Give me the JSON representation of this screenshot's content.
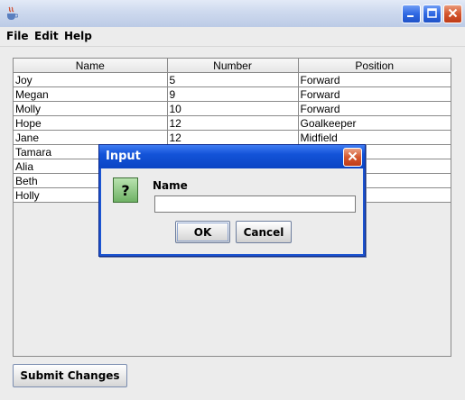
{
  "window": {
    "icons": [
      "java-cup-icon",
      "minimize-icon",
      "maximize-icon",
      "close-icon"
    ]
  },
  "menu": [
    "File",
    "Edit",
    "Help"
  ],
  "table": {
    "columns": [
      "Name",
      "Number",
      "Position"
    ],
    "rows": [
      [
        "Joy",
        "5",
        "Forward"
      ],
      [
        "Megan",
        "9",
        "Forward"
      ],
      [
        "Molly",
        "10",
        "Forward"
      ],
      [
        "Hope",
        "12",
        "Goalkeeper"
      ],
      [
        "Jane",
        "12",
        "Midfield"
      ],
      [
        "Tamara",
        "",
        ""
      ],
      [
        "Alia",
        "",
        ""
      ],
      [
        "Beth",
        "",
        ""
      ],
      [
        "Holly",
        "",
        ""
      ]
    ]
  },
  "submit_label": "Submit Changes",
  "dialog": {
    "title": "Input",
    "field_label": "Name",
    "field_value": "",
    "ok_label": "OK",
    "cancel_label": "Cancel",
    "icon": "question-icon"
  },
  "colors": {
    "titlebar_accent": "#1353d8",
    "close_button": "#d4582f",
    "question_icon": "#6fb165"
  }
}
